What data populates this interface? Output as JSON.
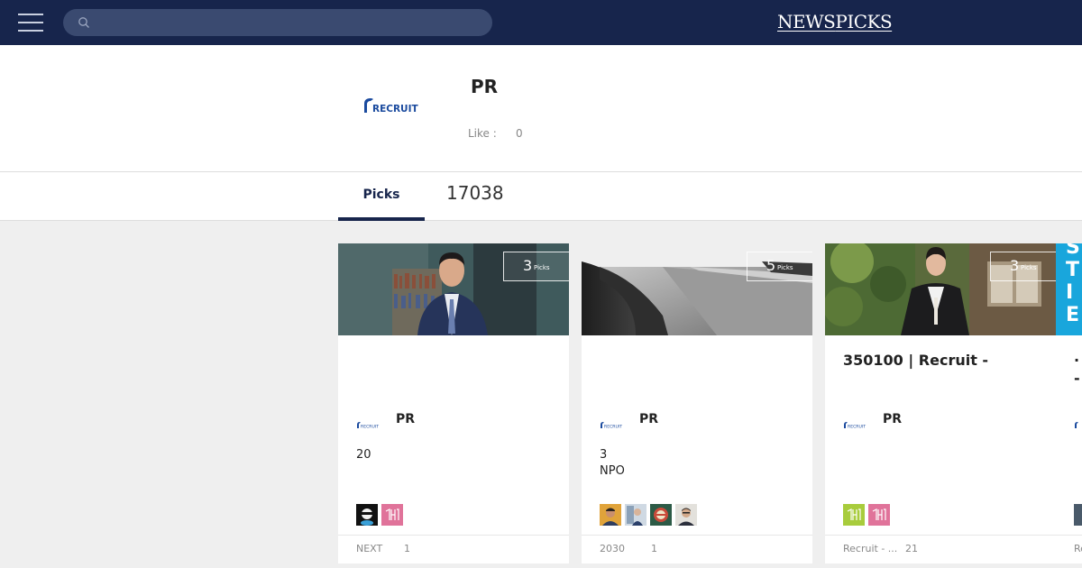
{
  "header": {
    "logo_part1": "NEWS",
    "logo_part2": "PICKS",
    "search_placeholder": ""
  },
  "profile": {
    "name": "PR",
    "like_label": "Like :",
    "like_count": "0"
  },
  "tabs": {
    "picks_label": "Picks",
    "picks_count": "17038"
  },
  "cards": [
    {
      "badge_count": "3",
      "badge_label": "Picks",
      "title": "",
      "publisher": "PR",
      "text_lines": [
        "20"
      ],
      "footer_source": "NEXT",
      "footer_count": "1"
    },
    {
      "badge_count": "5",
      "badge_label": "Picks",
      "title": "",
      "publisher": "PR",
      "text_lines": [
        "3",
        "NPO"
      ],
      "footer_source": "2030",
      "footer_count": "1"
    },
    {
      "badge_count": "3",
      "badge_label": "Picks",
      "title": "350100 | Recruit -",
      "publisher": "PR",
      "text_lines": [],
      "footer_source": "Recruit - ...",
      "footer_count": "21"
    }
  ],
  "partial_card": {
    "image_letters": [
      "S",
      "T",
      "I",
      "E"
    ],
    "title_fragment_1": ".",
    "title_fragment_2": "-",
    "footer_fragment": "Re"
  },
  "colors": {
    "topbar": "#17254c",
    "accent": "#17254c",
    "recruit_blue": "#1a4a9e"
  }
}
